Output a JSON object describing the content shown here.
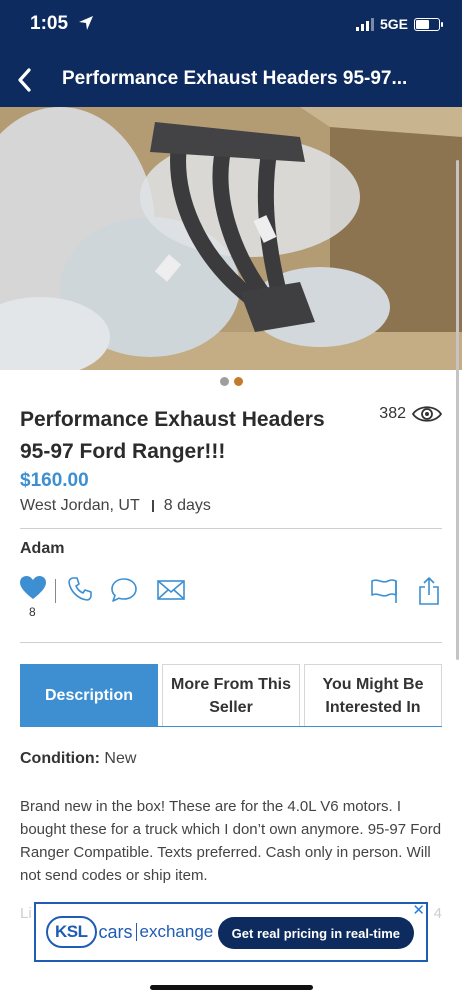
{
  "status_bar": {
    "time": "1:05",
    "network": "5GE"
  },
  "nav": {
    "title": "Performance Exhaust Headers 95-97..."
  },
  "gallery": {
    "count": 2,
    "active": 2
  },
  "listing": {
    "title": "Performance Exhaust Headers 95-97 Ford Ranger!!!",
    "views": "382",
    "price": "$160.00",
    "location": "West Jordan, UT",
    "posted": "8 days",
    "seller": "Adam",
    "favorites": "8"
  },
  "tabs": [
    {
      "label": "Description",
      "active": true
    },
    {
      "label": "More From This Seller",
      "active": false
    },
    {
      "label": "You Might Be Interested In",
      "active": false
    }
  ],
  "details": {
    "condition_label": "Condition:",
    "condition_value": "New",
    "description": "Brand new in the box! These are for the 4.0L V6 motors. I bought these for a truck which I don’t own anymore. 95-97 Ford Ranger Compatible. Texts preferred. Cash only in person. Will not send codes or ship item."
  },
  "ad": {
    "logo_ksl": "KSL",
    "logo_cars": "cars",
    "logo_exchange": "exchange",
    "cta": "Get real pricing in real-time",
    "close": "✕"
  },
  "colors": {
    "header": "#0d2b5e",
    "accent": "#3d8fd1",
    "dot_active": "#c47a2c"
  }
}
